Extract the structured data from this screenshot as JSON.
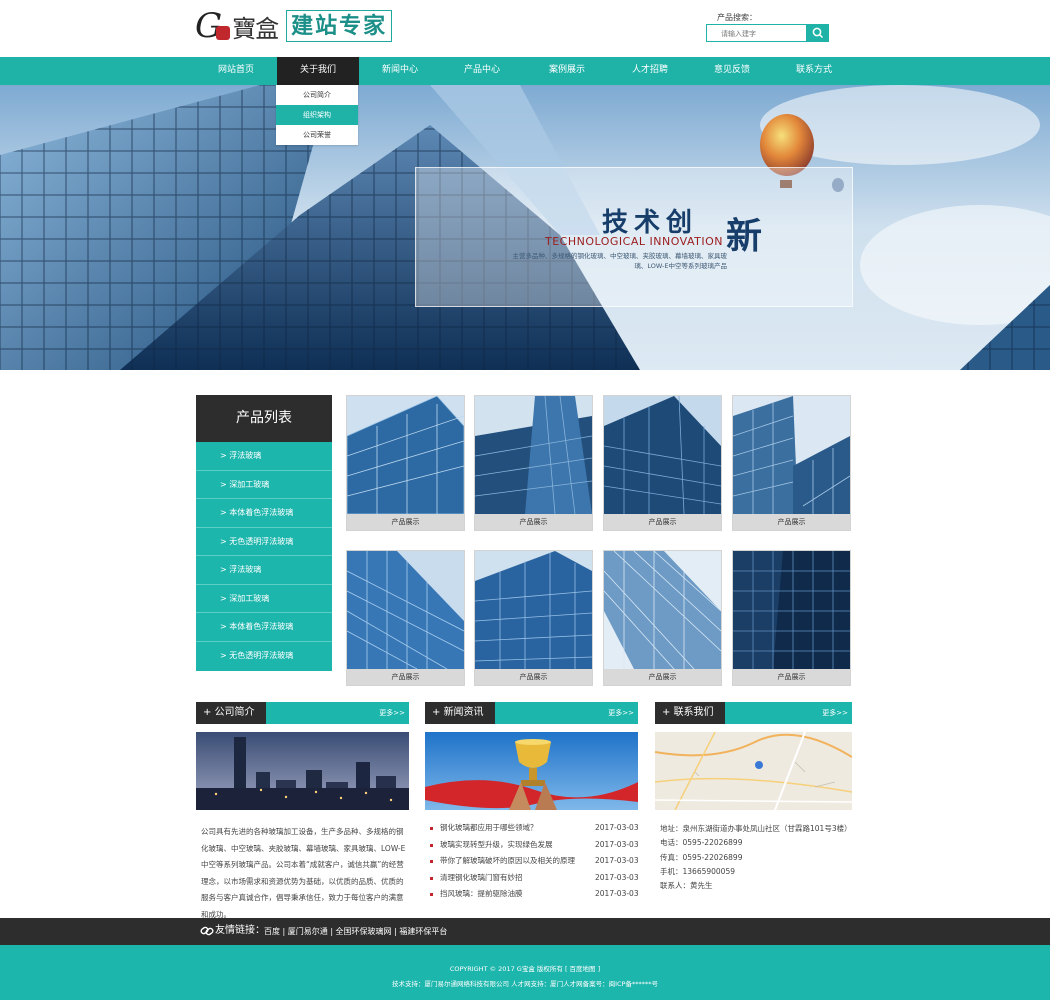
{
  "header": {
    "logo_g": "G",
    "logo_bao": "寶盒",
    "logo_tagline": "建站专家",
    "search_label": "产品搜索：",
    "search_placeholder": "请输入建字"
  },
  "nav": {
    "items": [
      "网站首页",
      "关于我们",
      "新闻中心",
      "产品中心",
      "案例展示",
      "人才招聘",
      "意见反馈",
      "联系方式"
    ],
    "active_index": 1
  },
  "dropdown": {
    "items": [
      "公司简介",
      "组织架构",
      "公司荣誉"
    ],
    "selected_index": 1
  },
  "banner": {
    "title_main": "技术创",
    "title_last": "新",
    "subtitle_en": "TECHNOLOGICAL INNOVATION",
    "description": "主营多品种、多规格的钢化玻璃、中空玻璃、夹胶玻璃、幕墙玻璃、家具玻璃、LOW-E中空等系列玻璃产品"
  },
  "product_list": {
    "title": "产品列表",
    "items": [
      "> 浮法玻璃",
      "> 深加工玻璃",
      "> 本体着色浮法玻璃",
      "> 无色透明浮法玻璃",
      "> 浮法玻璃",
      "> 深加工玻璃",
      "> 本体着色浮法玻璃",
      "> 无色透明浮法玻璃"
    ]
  },
  "products": {
    "captions": [
      "产品展示",
      "产品展示",
      "产品展示",
      "产品展示",
      "产品展示",
      "产品展示",
      "产品展示",
      "产品展示"
    ]
  },
  "company": {
    "title": "公司简介",
    "more": "更多>>",
    "text": "公司具有先进的各种玻璃加工设备，生产多品种、多规格的钢化玻璃、中空玻璃、夹胶玻璃、幕墙玻璃、家具玻璃、LOW-E中空等系列玻璃产品。公司本着“成就客户，诚信共赢”的经营理念，以市场需求和资源优势为基础，以优质的品质、优质的服务与客户真诚合作，倡导秉承信任，致力于每位客户的满意和成功。"
  },
  "news": {
    "title": "新闻资讯",
    "more": "更多>>",
    "items": [
      {
        "title": "钢化玻璃都应用于哪些领域？",
        "date": "2017-03-03"
      },
      {
        "title": "玻璃实现转型升级，实现绿色发展",
        "date": "2017-03-03"
      },
      {
        "title": "带你了解玻璃破坏的原因以及相关的原理",
        "date": "2017-03-03"
      },
      {
        "title": "清理钢化玻璃门窗有妙招",
        "date": "2017-03-03"
      },
      {
        "title": "挡风玻璃：提前驱除油膜",
        "date": "2017-03-03"
      }
    ]
  },
  "contact": {
    "title": "联系我们",
    "more": "更多>>",
    "address": "地址：泉州东湖街道办事处凤山社区（甘霖路101号3楼）",
    "phone": "电话：0595-22026899",
    "fax": "传真：0595-22026899",
    "mobile": "手机：13665900059",
    "person": "联系人：黄先生"
  },
  "links": {
    "label": "友情链接：",
    "value": "百度 | 厦门易尔通 | 全国环保玻璃网 | 福建环保平台"
  },
  "footer": {
    "line1": "COPYRIGHT © 2017 G宝盒 版权所有 [ 百度地图 ]",
    "line2": "技术支持：厦门易尔通网络科技有限公司 人才网支持：厦门人才网备案号：闽ICP备******号"
  },
  "colors": {
    "teal": "#1fb3a8",
    "dark": "#2d2d2d",
    "accent_red": "#c0282d"
  }
}
